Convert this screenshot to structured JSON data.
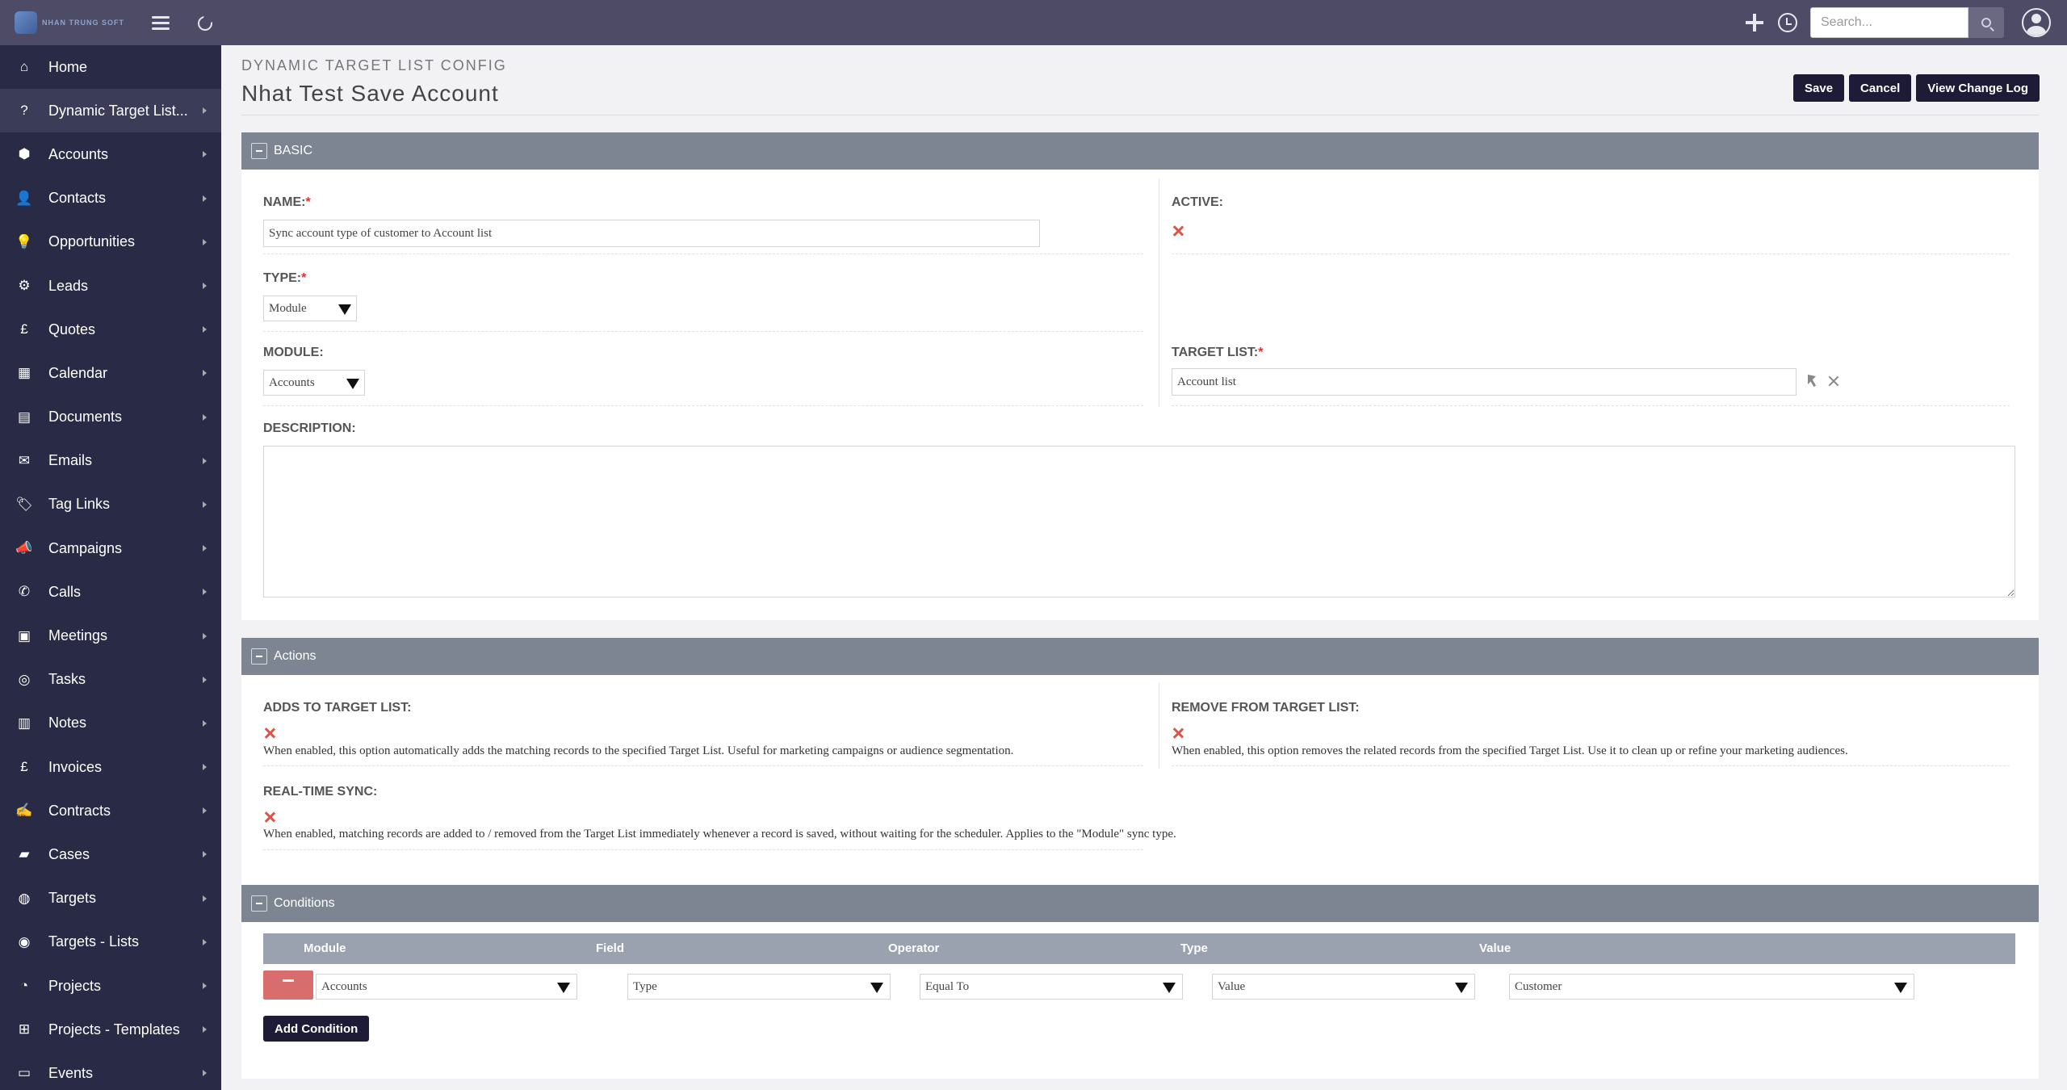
{
  "topbar": {
    "logo_text": "NHAN TRUNG SOFT",
    "search_placeholder": "Search..."
  },
  "sidebar": {
    "items": [
      {
        "label": "Home",
        "icon": "⌂"
      },
      {
        "label": "Dynamic Target List...",
        "icon": "?"
      },
      {
        "label": "Accounts",
        "icon": "⬢"
      },
      {
        "label": "Contacts",
        "icon": "👤"
      },
      {
        "label": "Opportunities",
        "icon": "💡"
      },
      {
        "label": "Leads",
        "icon": "⚙"
      },
      {
        "label": "Quotes",
        "icon": "£"
      },
      {
        "label": "Calendar",
        "icon": "▦"
      },
      {
        "label": "Documents",
        "icon": "▤"
      },
      {
        "label": "Emails",
        "icon": "✉"
      },
      {
        "label": "Tag Links",
        "icon": "🏷"
      },
      {
        "label": "Campaigns",
        "icon": "📣"
      },
      {
        "label": "Calls",
        "icon": "✆"
      },
      {
        "label": "Meetings",
        "icon": "▣"
      },
      {
        "label": "Tasks",
        "icon": "◎"
      },
      {
        "label": "Notes",
        "icon": "▥"
      },
      {
        "label": "Invoices",
        "icon": "£"
      },
      {
        "label": "Contracts",
        "icon": "✍"
      },
      {
        "label": "Cases",
        "icon": "▰"
      },
      {
        "label": "Targets",
        "icon": "◍"
      },
      {
        "label": "Targets - Lists",
        "icon": "◉"
      },
      {
        "label": "Projects",
        "icon": "◔"
      },
      {
        "label": "Projects - Templates",
        "icon": "⊞"
      },
      {
        "label": "Events",
        "icon": "▭"
      }
    ]
  },
  "header": {
    "module_title": "DYNAMIC TARGET LIST CONFIG",
    "record_title": "Nhat Test Save Account",
    "save_label": "Save",
    "cancel_label": "Cancel",
    "change_log_label": "View Change Log"
  },
  "basic": {
    "panel_title": "BASIC",
    "name_label": "NAME:",
    "name_value": "Sync account type of customer to Account list",
    "active_label": "ACTIVE:",
    "type_label": "TYPE:",
    "type_value": "Module",
    "module_label": "MODULE:",
    "module_value": "Accounts",
    "target_list_label": "TARGET LIST:",
    "target_list_value": "Account list",
    "description_label": "DESCRIPTION:",
    "required_mark": "*"
  },
  "actions": {
    "panel_title": "Actions",
    "adds_label": "ADDS TO TARGET LIST:",
    "adds_help": "When enabled, this option automatically adds the matching records to the specified Target List. Useful for marketing campaigns or audience segmentation.",
    "remove_label": "REMOVE FROM TARGET LIST:",
    "remove_help": "When enabled, this option removes the related records from the specified Target List. Use it to clean up or refine your marketing audiences.",
    "realtime_label": "REAL-TIME SYNC:",
    "realtime_help": "When enabled, matching records are added to / removed from the Target List immediately whenever a record is saved, without waiting for the scheduler. Applies to the \"Module\" sync type."
  },
  "conditions": {
    "panel_title": "Conditions",
    "columns": [
      "Module",
      "Field",
      "Operator",
      "Type",
      "Value"
    ],
    "rows": [
      {
        "module": "Accounts",
        "field": "Type",
        "operator": "Equal To",
        "type": "Value",
        "value": "Customer"
      }
    ],
    "add_label": "Add Condition"
  }
}
